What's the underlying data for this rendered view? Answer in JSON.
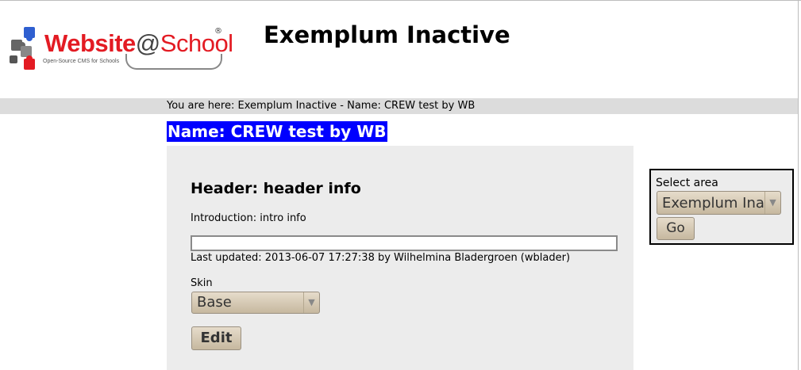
{
  "logo": {
    "brand_part1": "Website",
    "brand_at": "@",
    "brand_part2": "School",
    "registered": "®",
    "tagline": "Open-Source CMS for Schools"
  },
  "site": {
    "title": "Exemplum Inactive"
  },
  "breadcrumb": {
    "text": "You are here: Exemplum Inactive - Name: CREW test by WB"
  },
  "page": {
    "title": "Name: CREW test by WB"
  },
  "content": {
    "header": "Header: header info",
    "introduction": "Introduction: intro info",
    "last_updated": "Last updated: 2013-06-07 17:27:38 by Wilhelmina Bladergroen (wblader)",
    "skin_label": "Skin",
    "skin_selected": "Base",
    "edit_label": "Edit"
  },
  "area_selector": {
    "label": "Select area",
    "selected": "Exemplum Inactive",
    "go_label": "Go"
  },
  "icons": {
    "select_arrow": "chevron-down-icon",
    "logo_puzzle": "puzzle-icon"
  },
  "colors": {
    "title_highlight": "#0000ff",
    "logo_red": "#e31b23",
    "breadcrumb_bg": "#dcdcdc",
    "panel_bg": "#ececec"
  }
}
